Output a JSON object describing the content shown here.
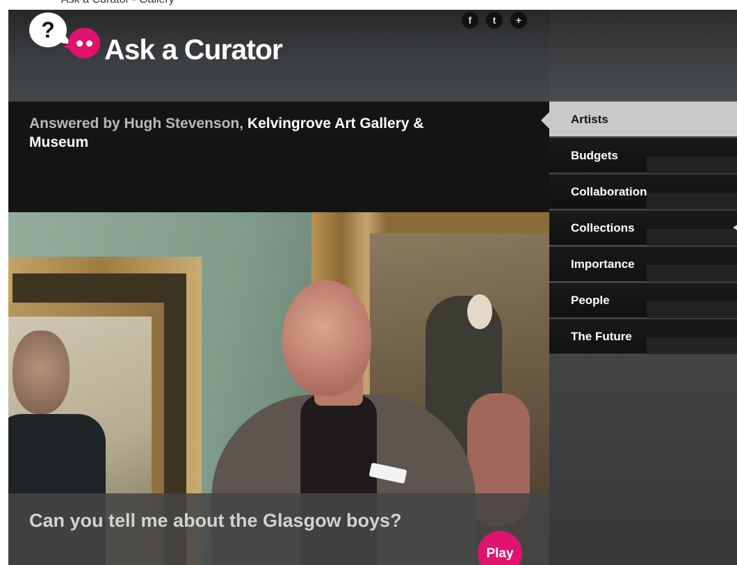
{
  "top_strip_text": "Ask a Curator - Gallery",
  "logo": {
    "text": "Ask a Curator",
    "question_glyph": "?"
  },
  "social": [
    {
      "glyph": "f",
      "icon": "facebook-icon"
    },
    {
      "glyph": "t",
      "icon": "twitter-icon"
    },
    {
      "glyph": "+",
      "icon": "share-plus-icon"
    }
  ],
  "answered": {
    "prefix": "Answered by Hugh Stevenson,",
    "venue": "Kelvingrove Art Gallery & Museum"
  },
  "video": {
    "question": "Can you tell me about the Glasgow boys?",
    "play_label": "Play"
  },
  "nav": {
    "items": [
      {
        "label": "Artists",
        "active": true
      },
      {
        "label": "Budgets",
        "active": false
      },
      {
        "label": "Collaboration",
        "active": false
      },
      {
        "label": "Collections",
        "active": false
      },
      {
        "label": "Importance",
        "active": false
      },
      {
        "label": "People",
        "active": false
      },
      {
        "label": "The Future",
        "active": false
      }
    ]
  },
  "colors": {
    "brand_pink": "#e0136f",
    "header_dark": "#3b3e41",
    "answered_bg": "#141414",
    "nav_active": "#c9c9c9"
  }
}
